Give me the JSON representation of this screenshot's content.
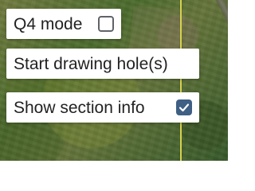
{
  "map": {
    "background_colors": [
      "#6f7a3e",
      "#4b6b2d",
      "#65743a",
      "#36592a"
    ],
    "boundary_color": "#d7d34f"
  },
  "controls": {
    "q4_mode": {
      "label": "Q4 mode",
      "checked": false
    },
    "draw_holes": {
      "label": "Start drawing hole(s)"
    },
    "section_info": {
      "label": "Show section info",
      "checked": true,
      "accent_color": "#3f5f84"
    }
  }
}
